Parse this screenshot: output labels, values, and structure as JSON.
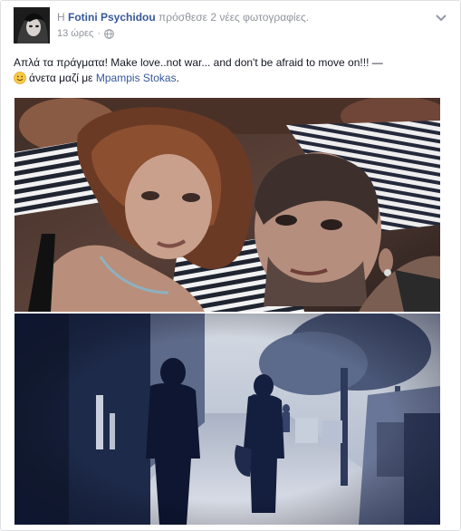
{
  "post": {
    "author_prefix": "Η",
    "author": "Fotini Psychidou",
    "action": "πρόσθεσε 2 νέες φωτογραφίες.",
    "timestamp": "13 ώρες",
    "separator": "·",
    "privacy_icon": "globe-icon",
    "menu_icon": "chevron-down-icon",
    "text": "Απλά τα πράγματα! Make love..not war... and don't be afraid to move on!!! —",
    "feeling_icon": "smiley-icon",
    "feeling_text": "άνετα μαζί με",
    "tagged_person": "Mpampis Stokas",
    "tag_suffix": ".",
    "photos": [
      {
        "description_icon": "photo-couple-selfie"
      },
      {
        "description_icon": "photo-street-walkers"
      }
    ]
  },
  "colors": {
    "link": "#365899",
    "meta": "#90949c",
    "text": "#141823",
    "border": "#dddfe2"
  }
}
